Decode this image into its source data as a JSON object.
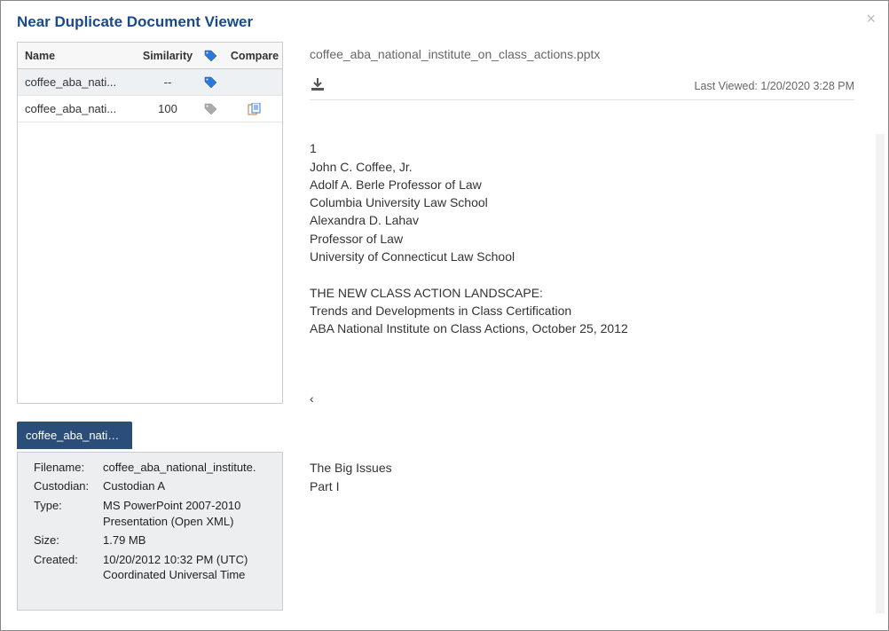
{
  "window": {
    "title": "Near Duplicate Document Viewer"
  },
  "table": {
    "headers": {
      "name": "Name",
      "similarity": "Similarity",
      "compare": "Compare"
    },
    "rows": [
      {
        "name": "coffee_aba_nati...",
        "similarity": "--",
        "tag": "blue",
        "compare": ""
      },
      {
        "name": "coffee_aba_nati...",
        "similarity": "100",
        "tag": "grey",
        "compare": "icon"
      }
    ]
  },
  "tab": {
    "label": "coffee_aba_natio..."
  },
  "meta": {
    "filename_label": "Filename:",
    "filename": "coffee_aba_national_institute.",
    "custodian_label": "Custodian:",
    "custodian": "Custodian A",
    "type_label": "Type:",
    "type": "MS PowerPoint 2007-2010 Presentation (Open XML)",
    "size_label": "Size:",
    "size": "1.79 MB",
    "created_label": "Created:",
    "created": "10/20/2012 10:32 PM (UTC) Coordinated Universal Time"
  },
  "doc": {
    "title": "coffee_aba_national_institute_on_class_actions.pptx",
    "last_viewed": "Last Viewed: 1/20/2020 3:28 PM",
    "block1": "1\nJohn C. Coffee, Jr.\nAdolf A. Berle Professor of Law\nColumbia University Law School\nAlexandra D. Lahav\nProfessor of Law\nUniversity of Connecticut Law School\n\nTHE NEW CLASS ACTION LANDSCAPE:\nTrends and Developments in Class Certification\nABA National Institute on Class Actions, October 25, 2012",
    "marker": "‹",
    "block2": "The Big Issues\nPart I"
  }
}
